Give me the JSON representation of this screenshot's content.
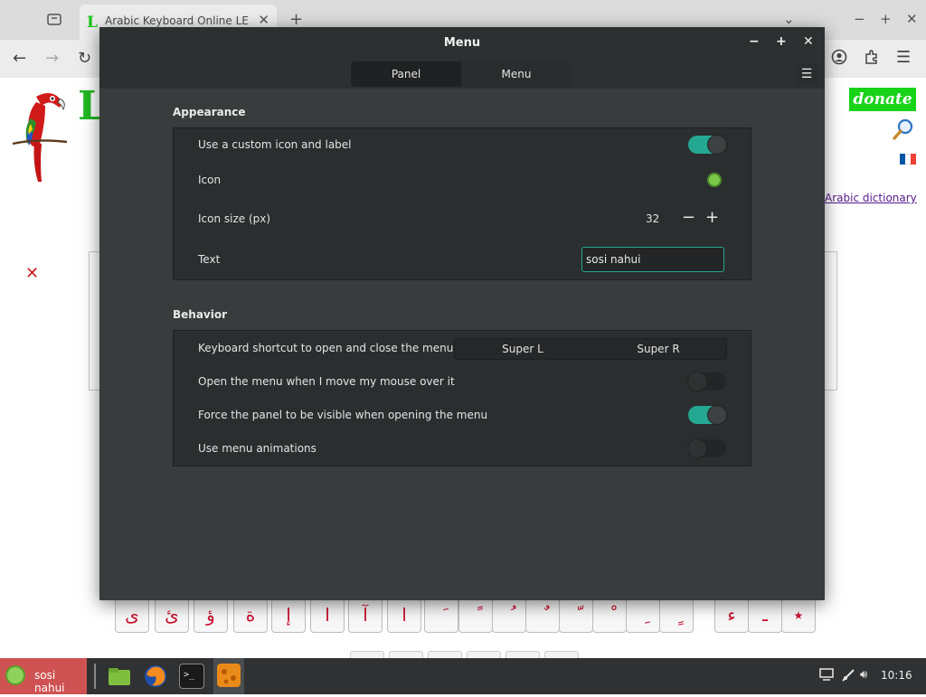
{
  "browser": {
    "tab_title": "Arabic Keyboard Online LEXILO",
    "tab_close": "✕",
    "new_tab": "+",
    "window_controls": [
      "−",
      "+",
      "✕"
    ],
    "nav_icons": [
      "back-icon",
      "forward-icon",
      "reload-icon",
      "account-icon",
      "extensions-icon",
      "menu-icon"
    ]
  },
  "page": {
    "logo_letter": "L",
    "donate_label": "donate",
    "dictionary_link": "Arabic dictionary",
    "close_mark": "✕",
    "flag_colors": [
      "#0055a4",
      "#ffffff",
      "#ef4135"
    ],
    "keys": [
      "ى",
      "ئ",
      "ؤ",
      "ة",
      "إ",
      "ا",
      "آ",
      "ا",
      "َ",
      "ً",
      "ُ",
      "ٌ",
      "ّ",
      "ْ",
      "ِ",
      "ٍ",
      "ء",
      "ـ",
      "٭"
    ]
  },
  "dialog": {
    "title": "Menu",
    "controls": [
      "−",
      "+",
      "✕"
    ],
    "tabs": [
      {
        "label": "Panel",
        "active": true
      },
      {
        "label": "Menu",
        "active": false
      }
    ],
    "hamburger": "☰",
    "appearance": {
      "title": "Appearance",
      "custom_icon_label": "Use a custom icon and label",
      "custom_icon_enabled": true,
      "icon_label": "Icon",
      "icon_size_label": "Icon size (px)",
      "icon_size_value": "32",
      "text_label": "Text",
      "text_value": "sosi nahui"
    },
    "behavior": {
      "title": "Behavior",
      "shortcut_label": "Keyboard shortcut to open and close the menu",
      "shortcut_1": "Super L",
      "shortcut_2": "Super R",
      "hover_label": "Open the menu when I move my mouse over it",
      "hover_enabled": false,
      "force_visible_label": "Force the panel to be visible when opening the menu",
      "force_visible_enabled": true,
      "animations_label": "Use menu animations",
      "animations_enabled": false
    },
    "accent_color": "#24a892"
  },
  "taskbar": {
    "menu_label": "sosi nahui",
    "clock": "10:16",
    "apps": [
      "files-icon",
      "firefox-icon",
      "terminal-icon",
      "app-icon"
    ]
  }
}
